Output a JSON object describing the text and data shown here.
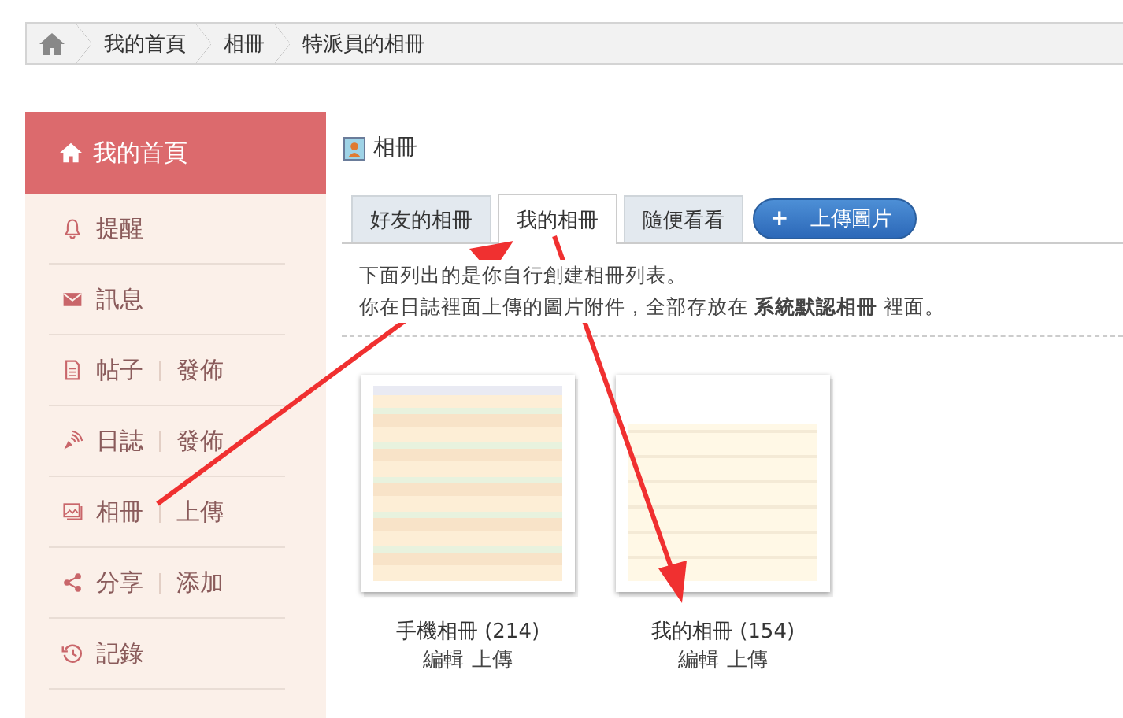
{
  "breadcrumb": [
    {
      "label": "我的首頁"
    },
    {
      "label": "相冊"
    },
    {
      "label": "特派員的相冊"
    }
  ],
  "sidebar": {
    "header": "我的首頁",
    "items": [
      {
        "label": "提醒"
      },
      {
        "label": "訊息"
      },
      {
        "label": "帖子",
        "action": "發佈"
      },
      {
        "label": "日誌",
        "action": "發佈"
      },
      {
        "label": "相冊",
        "action": "上傳"
      },
      {
        "label": "分享",
        "action": "添加"
      },
      {
        "label": "記錄"
      }
    ]
  },
  "page_title": "相冊",
  "tabs": [
    {
      "label": "好友的相冊",
      "selected": false
    },
    {
      "label": "我的相冊",
      "selected": true
    },
    {
      "label": "隨便看看",
      "selected": false
    }
  ],
  "upload_button": {
    "icon": "+",
    "label": "上傳圖片"
  },
  "description": [
    "下面列出的是你自行創建相冊列表。",
    "你在日誌裡面上傳的圖片附件，全部存放在 **系統默認相冊** 裡面。"
  ],
  "albums": [
    {
      "title": "手機相冊 (214)",
      "links": [
        "編輯",
        "上傳"
      ]
    },
    {
      "title": "我的相冊 (154)",
      "links": [
        "編輯",
        "上傳"
      ]
    }
  ]
}
